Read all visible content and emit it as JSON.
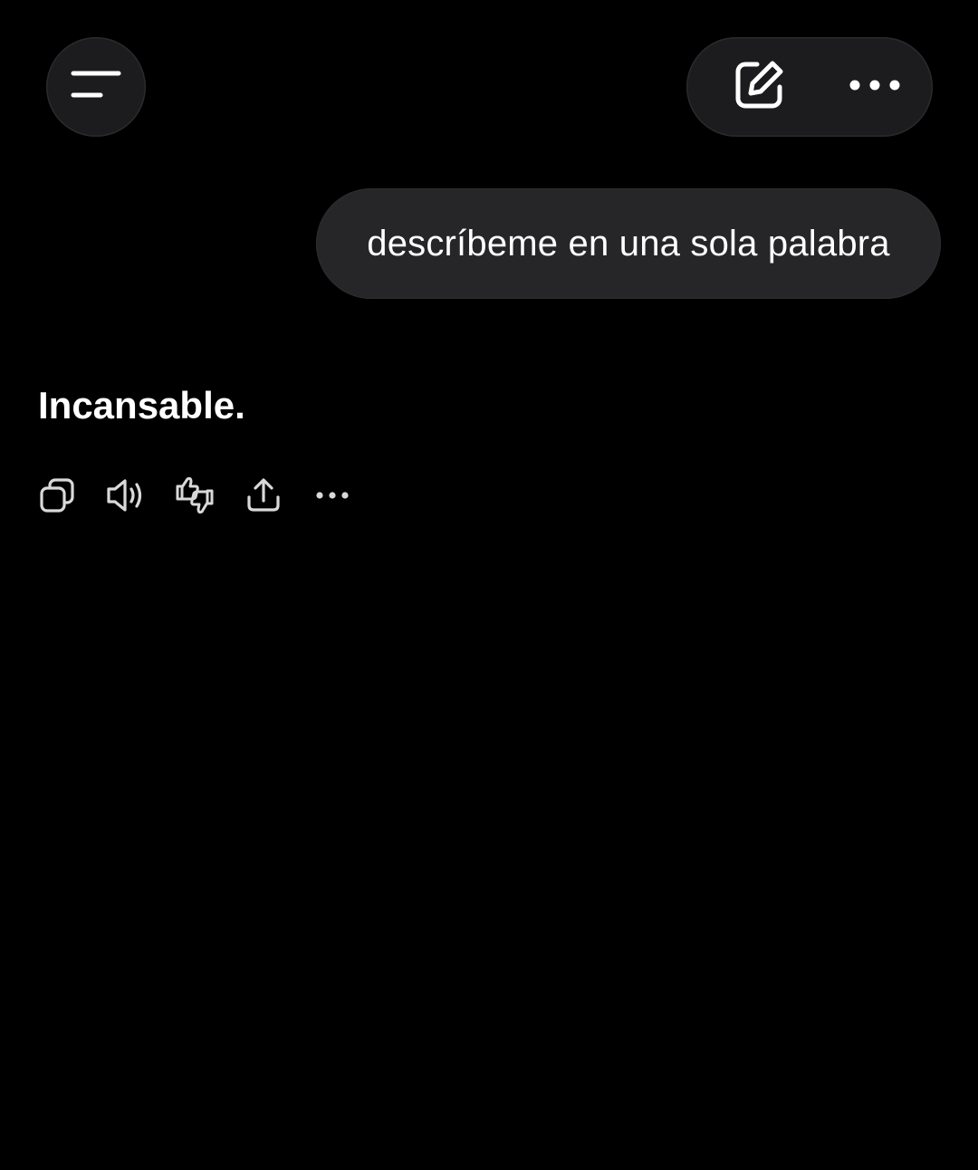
{
  "header": {
    "menu_icon": "menu-icon",
    "new_chat_icon": "edit-icon",
    "more_icon": "more-horizontal-icon"
  },
  "conversation": {
    "user_message": "descríbeme en una sola palabra",
    "assistant_message": "Incansable."
  },
  "message_actions": [
    {
      "icon": "copy-icon"
    },
    {
      "icon": "speaker-icon"
    },
    {
      "icon": "thumbs-feedback-icon"
    },
    {
      "icon": "share-icon"
    },
    {
      "icon": "more-horizontal-icon"
    }
  ],
  "colors": {
    "background": "#000000",
    "surface": "#1c1c1e",
    "bubble": "#262628",
    "text": "#ffffff",
    "icon": "#d9d9d9"
  }
}
